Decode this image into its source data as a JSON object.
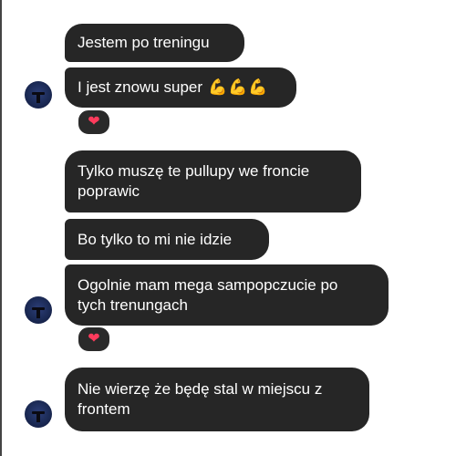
{
  "messages": [
    {
      "text": "Jestem po treningu"
    },
    {
      "text": "I jest znowu super",
      "emoji": "💪💪💪"
    },
    {
      "text": "Tylko muszę te pullupy we froncie\npoprawic"
    },
    {
      "text": "Bo tylko to mi nie idzie"
    },
    {
      "text": "Ogolnie mam mega sampopczucie po\ntych trenungach"
    },
    {
      "text": "Nie wierzę że będę stal w miejscu z\nfrontem"
    }
  ],
  "reactions": [
    {
      "icon": "heart-icon",
      "symbol": "❤"
    },
    {
      "icon": "heart-icon",
      "symbol": "❤"
    }
  ],
  "colors": {
    "bubble": "#262626",
    "bubble_text": "#ffffff",
    "reaction_heart": "#ff3b5c",
    "arm_emoji": "#f5b400"
  }
}
